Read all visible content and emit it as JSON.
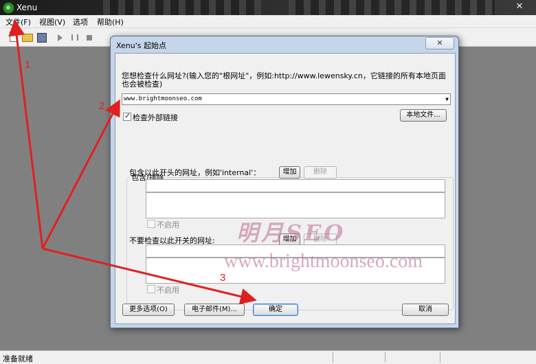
{
  "app": {
    "title": "Xenu"
  },
  "menu": [
    {
      "label": "文件(F)"
    },
    {
      "label": "视图(V)"
    },
    {
      "label": "选项"
    },
    {
      "label": "帮助(H)"
    }
  ],
  "status": {
    "text": "准备就绪"
  },
  "dialog": {
    "title": "Xenu's 起始点",
    "close_glyph": "✕",
    "prompt": "您想检查什么网址?(输入您的\"根网址\"，例如:http://www.lewensky.cn，它链接的所有本地页面也会被检查)",
    "url_value": "www.brightmoonseo.com",
    "check_external_label": "检查外部链接",
    "local_file_button": "本地文件...",
    "group_title": "包含/排除",
    "include_label": "包含以此开头的网址，例如'internal'：",
    "exclude_label": "不要检查以此开关的网址:",
    "add_button": "增加",
    "remove_button": "删除",
    "disable_label": "不启用",
    "more_options_button": "更多选项(O)",
    "email_button": "电子邮件(M)...",
    "ok_button": "确定",
    "cancel_button": "取消"
  },
  "watermark": {
    "title": "明月SEO",
    "url": "www.brightmoonseo.com"
  },
  "annotations": [
    "1",
    "2",
    "3"
  ],
  "colors": {
    "annotation": "#e02020"
  }
}
